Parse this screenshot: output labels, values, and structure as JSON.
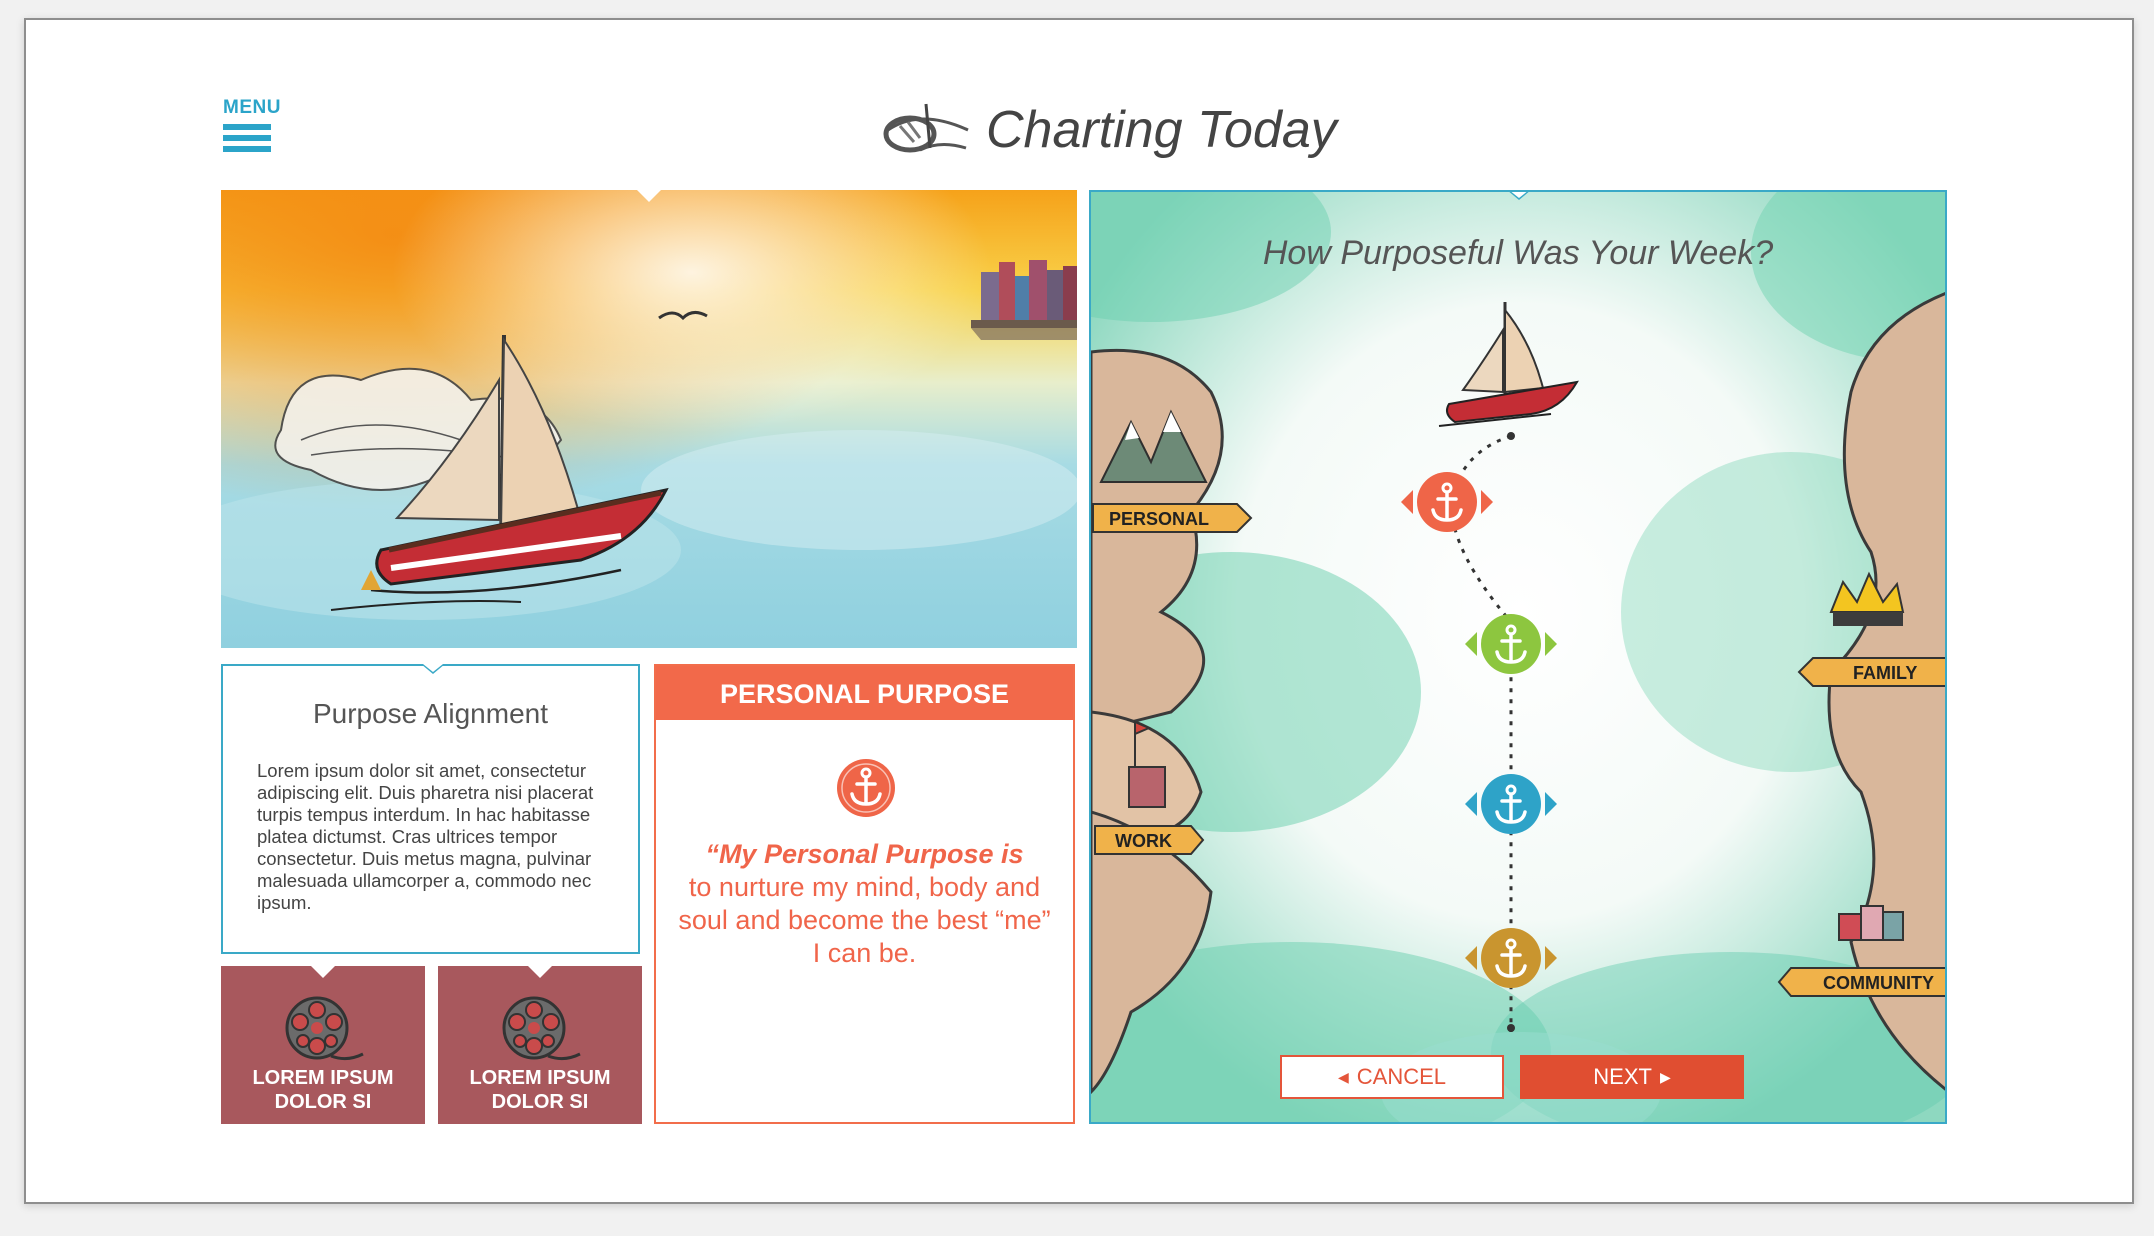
{
  "header": {
    "menu_label": "MENU",
    "app_title": "Charting Today"
  },
  "purpose_alignment": {
    "title": "Purpose Alignment",
    "body": "Lorem ipsum dolor sit amet, consectetur adipiscing elit. Duis pharetra nisi placerat turpis tempus interdum. In hac habitasse platea dictumst. Cras ultrices tempor consectetur. Duis metus magna, pulvinar malesuada ullamcorper a, commodo nec ipsum."
  },
  "video_tiles": [
    {
      "line1": "LOREM IPSUM",
      "line2": "DOLOR SI"
    },
    {
      "line1": "LOREM IPSUM",
      "line2": "DOLOR SI"
    }
  ],
  "personal_purpose": {
    "header": "PERSONAL PURPOSE",
    "quote_lead": "“My Personal Purpose is",
    "quote_rest": "to nurture my mind, body and soul and become the best “me” I can be."
  },
  "chart": {
    "question": "How Purposeful Was Your Week?",
    "islands": [
      {
        "label": "PERSONAL"
      },
      {
        "label": "WORK"
      },
      {
        "label": "FAMILY"
      },
      {
        "label": "COMMUNITY"
      }
    ],
    "anchor_colors": [
      "#ef6548",
      "#8dc63f",
      "#2ea3c8",
      "#c9952f"
    ],
    "cancel_label": "CANCEL",
    "next_label": "NEXT"
  },
  "icons": [
    "menu-icon",
    "logo-icon",
    "film-reel-icon",
    "anchor-icon",
    "sailboat-icon"
  ],
  "colors": {
    "accent_blue": "#2ba4c9",
    "accent_orange": "#f2694a",
    "tile_red": "#a8585d"
  }
}
